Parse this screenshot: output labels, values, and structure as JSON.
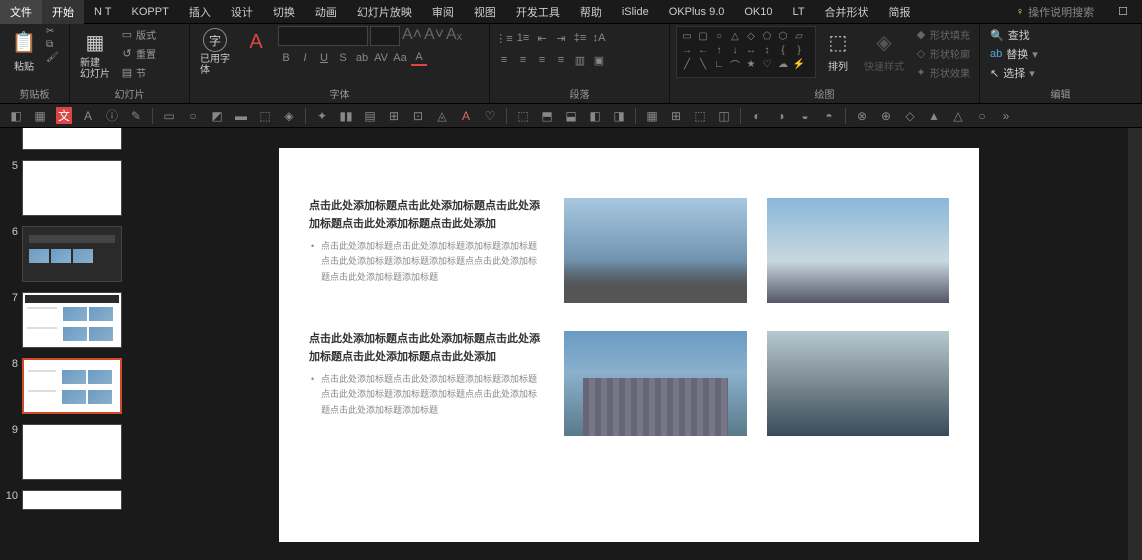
{
  "menubar": {
    "file": "文件",
    "tabs": [
      "开始",
      "N T",
      "KOPPT",
      "插入",
      "设计",
      "切换",
      "动画",
      "幻灯片放映",
      "审阅",
      "视图",
      "开发工具",
      "帮助",
      "iSlide",
      "OKPlus 9.0",
      "OK10",
      "LT",
      "合并形状",
      "简报"
    ],
    "search": "操作说明搜索",
    "share": "☐"
  },
  "ribbon": {
    "clipboard": {
      "label": "剪贴板",
      "paste": "粘贴"
    },
    "slides": {
      "label": "幻灯片",
      "new": "新建\n幻灯片",
      "layout": "版式",
      "reset": "重置",
      "section": "节"
    },
    "font": {
      "label": "字体",
      "usedfonts": "已用字\n体",
      "clear": "A"
    },
    "paragraph": {
      "label": "段落"
    },
    "drawing": {
      "label": "绘图",
      "arrange": "排列",
      "quickstyle": "快速样式",
      "fill": "形状填充",
      "outline": "形状轮廓",
      "effects": "形状效果"
    },
    "editing": {
      "label": "编辑",
      "find": "查找",
      "replace": "替换",
      "select": "选择"
    }
  },
  "thumbs": [
    {
      "n": "5",
      "type": "blank"
    },
    {
      "n": "6",
      "type": "dark"
    },
    {
      "n": "7",
      "type": "layout-a"
    },
    {
      "n": "8",
      "type": "layout-b",
      "active": true
    },
    {
      "n": "9",
      "type": "blank"
    },
    {
      "n": "10",
      "type": "blank"
    }
  ],
  "slide": {
    "title": "点击此处添加标题点击此处添加标题点击此处添加标题点击此处添加标题点击此处添加",
    "body": "点击此处添加标题点击此处添加标题添加标题添加标题点击此处添加标题添加标题添加标题点点击此处添加标题点击此处添加标题添加标题"
  }
}
